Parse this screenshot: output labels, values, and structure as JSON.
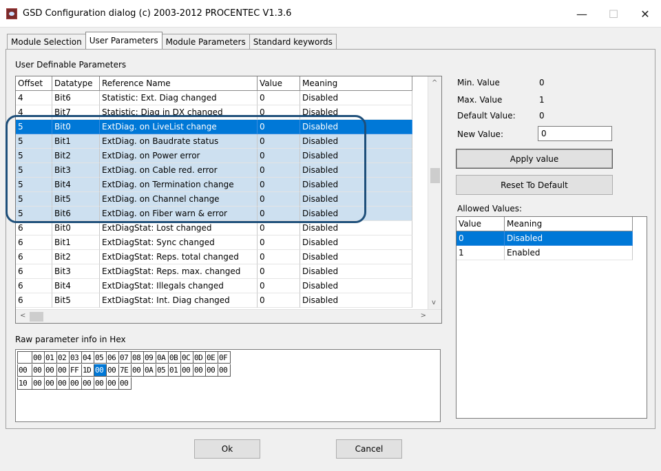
{
  "window": {
    "title": "GSD Configuration dialog (c) 2003-2012 PROCENTEC V1.3.6",
    "minimize": "—",
    "maximize": "☐",
    "close": "✕"
  },
  "tabs": [
    {
      "label": "Module Selection"
    },
    {
      "label": "User Parameters"
    },
    {
      "label": "Module Parameters"
    },
    {
      "label": "Standard keywords"
    }
  ],
  "labels": {
    "user_definable": "User Definable Parameters",
    "raw_hex": "Raw parameter info in Hex",
    "allowed_values": "Allowed Values:"
  },
  "params": {
    "columns": [
      "Offset",
      "Datatype",
      "Reference Name",
      "Value",
      "Meaning"
    ],
    "rows": [
      {
        "offset": "4",
        "type": "Bit6",
        "name": "Statistic: Ext. Diag changed",
        "value": "0",
        "meaning": "Disabled"
      },
      {
        "offset": "4",
        "type": "Bit7",
        "name": "Statistic: Diag in DX changed",
        "value": "0",
        "meaning": "Disabled"
      },
      {
        "offset": "5",
        "type": "Bit0",
        "name": "ExtDiag. on LiveList change",
        "value": "0",
        "meaning": "Disabled"
      },
      {
        "offset": "5",
        "type": "Bit1",
        "name": "ExtDiag. on Baudrate status",
        "value": "0",
        "meaning": "Disabled"
      },
      {
        "offset": "5",
        "type": "Bit2",
        "name": "ExtDiag. on Power error",
        "value": "0",
        "meaning": "Disabled"
      },
      {
        "offset": "5",
        "type": "Bit3",
        "name": "ExtDiag. on Cable red. error",
        "value": "0",
        "meaning": "Disabled"
      },
      {
        "offset": "5",
        "type": "Bit4",
        "name": "ExtDiag. on Termination change",
        "value": "0",
        "meaning": "Disabled"
      },
      {
        "offset": "5",
        "type": "Bit5",
        "name": "ExtDiag. on Channel change",
        "value": "0",
        "meaning": "Disabled"
      },
      {
        "offset": "5",
        "type": "Bit6",
        "name": "ExtDiag. on Fiber warn & error",
        "value": "0",
        "meaning": "Disabled"
      },
      {
        "offset": "6",
        "type": "Bit0",
        "name": "ExtDiagStat: Lost changed",
        "value": "0",
        "meaning": "Disabled"
      },
      {
        "offset": "6",
        "type": "Bit1",
        "name": "ExtDiagStat: Sync changed",
        "value": "0",
        "meaning": "Disabled"
      },
      {
        "offset": "6",
        "type": "Bit2",
        "name": "ExtDiagStat: Reps. total changed",
        "value": "0",
        "meaning": "Disabled"
      },
      {
        "offset": "6",
        "type": "Bit3",
        "name": "ExtDiagStat: Reps. max. changed",
        "value": "0",
        "meaning": "Disabled"
      },
      {
        "offset": "6",
        "type": "Bit4",
        "name": "ExtDiagStat: Illegals changed",
        "value": "0",
        "meaning": "Disabled"
      },
      {
        "offset": "6",
        "type": "Bit5",
        "name": "ExtDiagStat: Int. Diag changed",
        "value": "0",
        "meaning": "Disabled"
      }
    ]
  },
  "info": {
    "min_label": "Min. Value",
    "min_value": "0",
    "max_label": "Max. Value",
    "max_value": "1",
    "default_label": "Default Value:",
    "default_value": "0",
    "new_label": "New Value:",
    "new_value": "0"
  },
  "buttons": {
    "apply": "Apply value",
    "reset": "Reset To Default",
    "ok": "Ok",
    "cancel": "Cancel"
  },
  "allowed": {
    "columns": [
      "Value",
      "Meaning"
    ],
    "rows": [
      {
        "value": "0",
        "meaning": "Disabled"
      },
      {
        "value": "1",
        "meaning": "Enabled"
      }
    ]
  },
  "hex": {
    "columns": [
      "00",
      "01",
      "02",
      "03",
      "04",
      "05",
      "06",
      "07",
      "08",
      "09",
      "0A",
      "0B",
      "0C",
      "0D",
      "0E",
      "0F"
    ],
    "rows": [
      {
        "label": "00",
        "cells": [
          "00",
          "00",
          "00",
          "FF",
          "1D",
          "00",
          "00",
          "7E",
          "00",
          "0A",
          "05",
          "01",
          "00",
          "00",
          "00",
          "00"
        ]
      },
      {
        "label": "10",
        "cells": [
          "00",
          "00",
          "00",
          "00",
          "00",
          "00",
          "00",
          "00",
          "",
          "",
          "",
          "",
          "",
          "",
          "",
          ""
        ]
      }
    ]
  },
  "scroll": {
    "left": "<",
    "right": ">",
    "up": "^",
    "down": "v"
  }
}
